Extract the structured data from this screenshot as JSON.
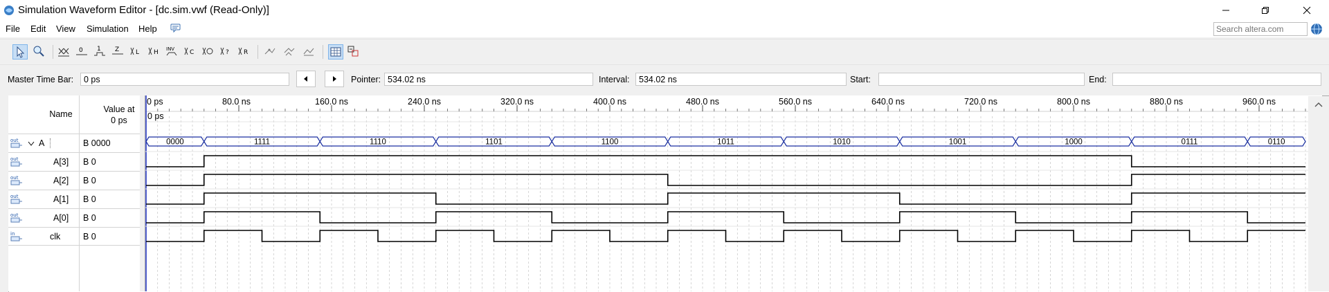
{
  "window": {
    "title": "Simulation Waveform Editor - [dc.sim.vwf (Read-Only)]",
    "buttons": [
      "minimize",
      "restore",
      "close"
    ]
  },
  "menu": [
    "File",
    "Edit",
    "View",
    "Simulation",
    "Help"
  ],
  "search": {
    "placeholder": "Search altera.com"
  },
  "toolbar": {
    "icons": [
      "selection-tool-icon",
      "zoom-tool-icon",
      "force-unknown-icon",
      "force-low-icon",
      "force-high-icon",
      "force-high-impedance-icon",
      "force-weak-low-icon",
      "force-weak-high-icon",
      "invert-icon",
      "count-value-icon",
      "clock-value-icon",
      "arbitrary-value-icon",
      "random-value-icon",
      "snap-to-grid-icon",
      "snap-to-transitions-icon",
      "reference-icon",
      "grid-icon",
      "timing-analyzer-icon"
    ]
  },
  "timebar": {
    "master_time_bar_label": "Master Time Bar:",
    "master_time_bar_value": "0 ps",
    "pointer_label": "Pointer:",
    "pointer_value": "534.02 ns",
    "interval_label": "Interval:",
    "interval_value": "534.02 ns",
    "start_label": "Start:",
    "start_value": "",
    "end_label": "End:",
    "end_value": ""
  },
  "columns": {
    "name": "Name",
    "value_at": "Value at",
    "value_at_time": "0 ps"
  },
  "signals": [
    {
      "name": "A",
      "value": "B 0000",
      "type": "out",
      "group": true
    },
    {
      "name": "A[3]",
      "value": "B 0",
      "type": "out"
    },
    {
      "name": "A[2]",
      "value": "B 0",
      "type": "out"
    },
    {
      "name": "A[1]",
      "value": "B 0",
      "type": "out"
    },
    {
      "name": "A[0]",
      "value": "B 0",
      "type": "out"
    },
    {
      "name": "clk",
      "value": "B 0",
      "type": "in"
    }
  ],
  "timeline": {
    "ticks": [
      "0 ps",
      "80.0 ns",
      "160.0 ns",
      "240.0 ns",
      "320.0 ns",
      "400.0 ns",
      "480.0 ns",
      "560.0 ns",
      "640.0 ns",
      "720.0 ns",
      "800.0 ns",
      "880.0 ns",
      "960.0 ns"
    ],
    "marker_label": "0 ps",
    "bus_values": [
      "0000",
      "1111",
      "1110",
      "1101",
      "1100",
      "1011",
      "1010",
      "1001",
      "1000",
      "0111",
      "0110"
    ]
  },
  "waveform": {
    "time_end_ns": 1000,
    "bus_transitions_ns": [
      0,
      50,
      150,
      250,
      350,
      450,
      550,
      650,
      750,
      850,
      950,
      1000
    ],
    "bits": {
      "A[3]": [
        [
          0,
          0
        ],
        [
          50,
          1
        ],
        [
          850,
          0
        ]
      ],
      "A[2]": [
        [
          0,
          0
        ],
        [
          50,
          1
        ],
        [
          450,
          0
        ],
        [
          850,
          1
        ]
      ],
      "A[1]": [
        [
          0,
          0
        ],
        [
          50,
          1
        ],
        [
          250,
          0
        ],
        [
          450,
          1
        ],
        [
          650,
          0
        ],
        [
          850,
          1
        ]
      ],
      "A[0]": [
        [
          0,
          0
        ],
        [
          50,
          1
        ],
        [
          150,
          0
        ],
        [
          250,
          1
        ],
        [
          350,
          0
        ],
        [
          450,
          1
        ],
        [
          550,
          0
        ],
        [
          650,
          1
        ],
        [
          750,
          0
        ],
        [
          850,
          1
        ],
        [
          950,
          0
        ]
      ],
      "clk": [
        [
          0,
          0
        ],
        [
          50,
          1
        ],
        [
          100,
          0
        ],
        [
          150,
          1
        ],
        [
          200,
          0
        ],
        [
          250,
          1
        ],
        [
          300,
          0
        ],
        [
          350,
          1
        ],
        [
          400,
          0
        ],
        [
          450,
          1
        ],
        [
          500,
          0
        ],
        [
          550,
          1
        ],
        [
          600,
          0
        ],
        [
          650,
          1
        ],
        [
          700,
          0
        ],
        [
          750,
          1
        ],
        [
          800,
          0
        ],
        [
          850,
          1
        ],
        [
          900,
          0
        ],
        [
          950,
          1
        ]
      ]
    }
  }
}
